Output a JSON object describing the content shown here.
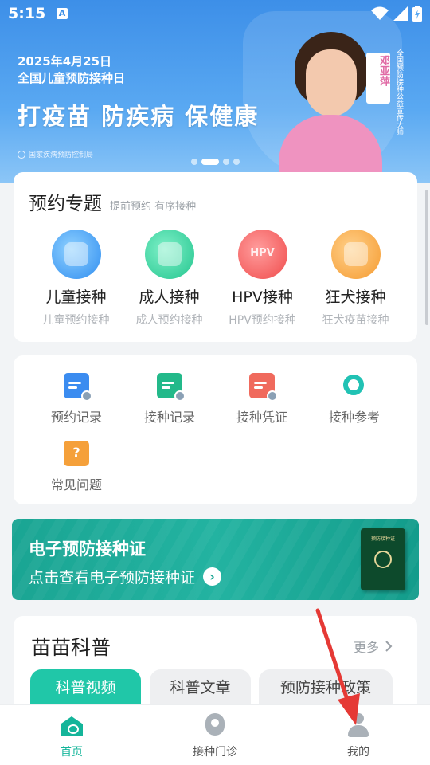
{
  "status_bar": {
    "time": "5:15",
    "notification_icon": "A"
  },
  "banner": {
    "date": "2025年4月25日",
    "day_name": "全国儿童预防接种日",
    "slogan": "打疫苗 防疾病 保健康",
    "org": "国家疾病预防控制局",
    "ambassador_name": "邓亚萍",
    "ambassador_title": "全国预防接种公益宣传大师",
    "carousel_pages": 4,
    "carousel_active": 2
  },
  "topics": {
    "title": "预约专题",
    "subtitle": "提前预约 有序接种",
    "items": [
      {
        "name": "儿童接种",
        "desc": "儿童预约接种",
        "icon": "child-icon"
      },
      {
        "name": "成人接种",
        "desc": "成人预约接种",
        "icon": "adult-icon"
      },
      {
        "name": "HPV接种",
        "desc": "HPV预约接种",
        "icon": "hpv-icon",
        "icon_text": "HPV"
      },
      {
        "name": "狂犬接种",
        "desc": "狂犬疫苗接种",
        "icon": "rabies-icon"
      }
    ]
  },
  "services": [
    {
      "label": "预约记录",
      "icon": "appointment-record-icon"
    },
    {
      "label": "接种记录",
      "icon": "vaccination-record-icon"
    },
    {
      "label": "接种凭证",
      "icon": "vaccination-certificate-icon"
    },
    {
      "label": "接种参考",
      "icon": "vaccination-reference-icon"
    },
    {
      "label": "常见问题",
      "icon": "faq-icon"
    }
  ],
  "certificate": {
    "title": "电子预防接种证",
    "link": "点击查看电子预防接种证",
    "book_title": "预防接种证"
  },
  "science": {
    "title": "苗苗科普",
    "more": "更多",
    "tabs": [
      "科普视频",
      "科普文章",
      "预防接种政策"
    ],
    "active_tab": 0
  },
  "bottom_nav": {
    "items": [
      {
        "label": "首页",
        "icon": "home-icon",
        "active": true
      },
      {
        "label": "接种门诊",
        "icon": "clinic-location-icon",
        "active": false
      },
      {
        "label": "我的",
        "icon": "profile-icon",
        "active": false
      }
    ]
  },
  "colors": {
    "accent": "#14b59a",
    "banner_blue": "#3d8fe8",
    "annotation_arrow": "#e53935"
  }
}
